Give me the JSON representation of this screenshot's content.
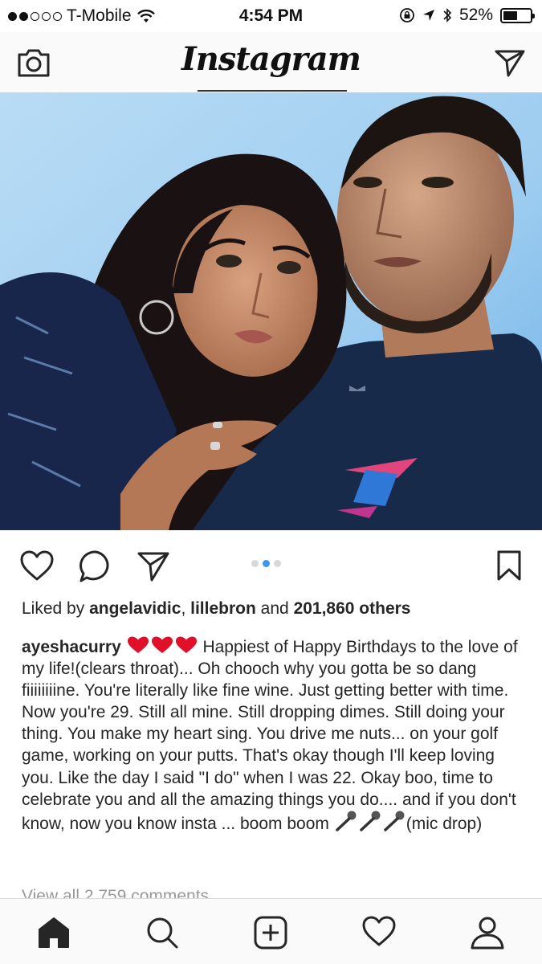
{
  "status_bar": {
    "carrier": "T-Mobile",
    "time": "4:54 PM",
    "battery": "52%",
    "battery_level": 0.52,
    "signal_bars_filled": 2,
    "signal_bars_total": 5
  },
  "header": {
    "logo": "Instagram",
    "camera_icon": "camera-icon",
    "direct_icon": "paper-plane-icon"
  },
  "post": {
    "carousel_index": 2,
    "carousel_count": 3,
    "likes": {
      "prefix": "Liked by",
      "user1": "angelavidic",
      "sep": ",",
      "user2": "lillebron",
      "and": "and",
      "count": "201,860 others"
    },
    "caption": {
      "username": "ayeshacurry",
      "text_part1": "Happiest of Happy Birthdays to the love of my life!(clears throat)... Oh chooch why you gotta be so dang fiiiiiiiine. You're literally like fine wine. Just getting better with time. Now you're 29. Still all mine. Still dropping dimes. Still doing your thing. You make my heart sing. You drive me nuts... on your golf game, working on your putts. That's okay though I'll keep loving you. Like the day I said \"I do\" when I was 22. Okay boo, time to celebrate you and all the amazing things you do.... and if you don't know, now you know insta ... boom boom",
      "text_part2": "(mic drop)"
    },
    "view_comments": "View all 2,759 comments"
  },
  "colors": {
    "accent_blue": "#3897f0",
    "heart_red": "#e0102a",
    "text": "#262626",
    "muted": "#999999"
  },
  "tabbar": {
    "items": [
      "home-icon",
      "search-icon",
      "add-post-icon",
      "activity-heart-icon",
      "profile-icon"
    ]
  }
}
